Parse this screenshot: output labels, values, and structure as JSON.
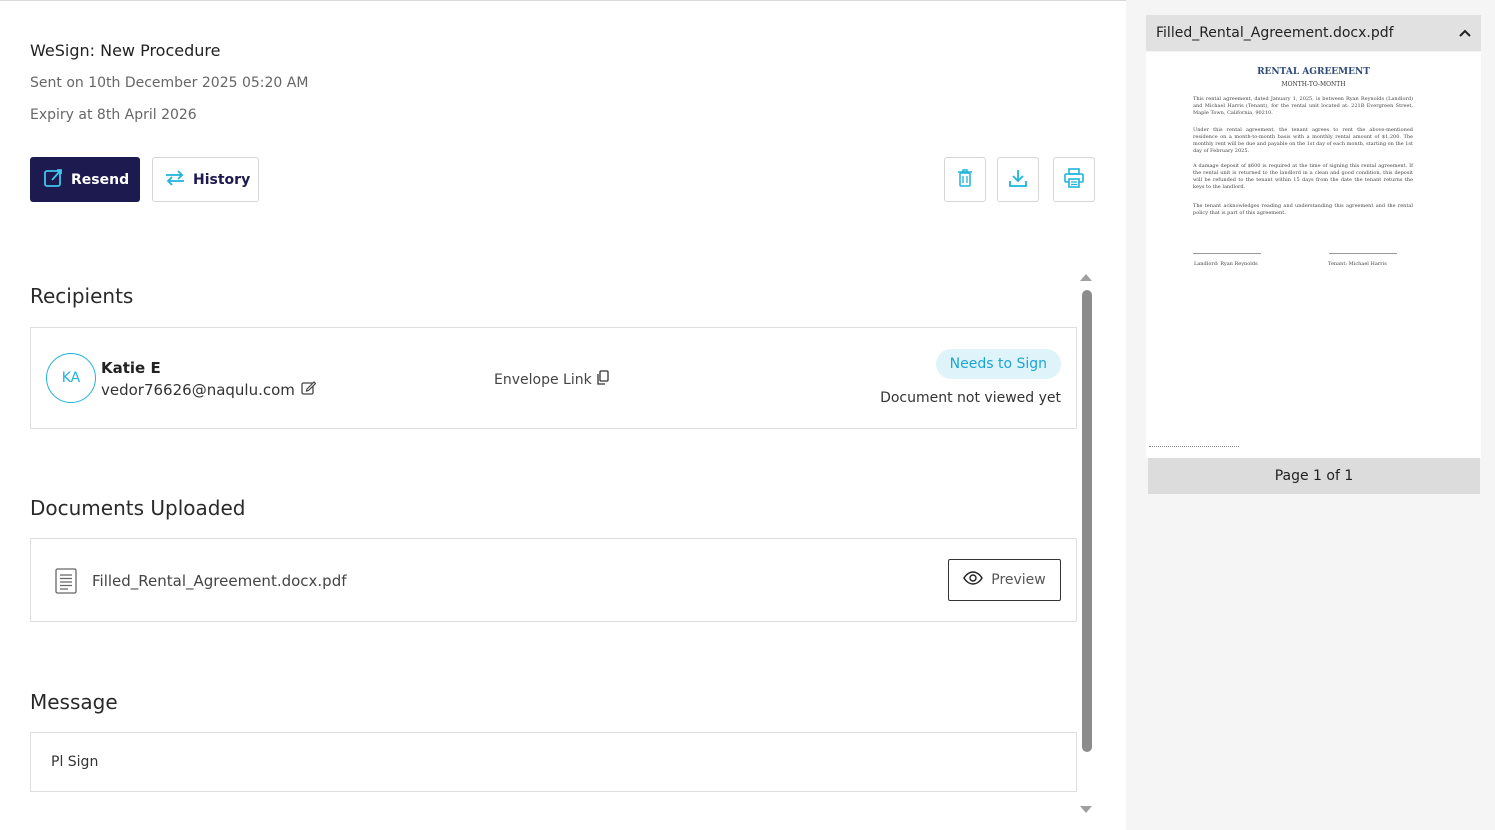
{
  "header": {
    "title": "WeSign: New Procedure",
    "sent": "Sent on 10th December 2025 05:20 AM",
    "expiry": "Expiry at 8th April 2026"
  },
  "actions": {
    "resend_label": "Resend",
    "history_label": "History",
    "icons": [
      "delete-icon",
      "download-icon",
      "print-icon"
    ]
  },
  "recipients": {
    "heading": "Recipients",
    "items": [
      {
        "initials": "KA",
        "name": "Katie E",
        "email": "vedor76626@naqulu.com",
        "envelope_link": "Envelope Link",
        "status": "Needs to Sign",
        "view_status": "Document not viewed yet"
      }
    ]
  },
  "documents": {
    "heading": "Documents Uploaded",
    "items": [
      {
        "name": "Filled_Rental_Agreement.docx.pdf",
        "preview_label": "Preview"
      }
    ]
  },
  "message": {
    "heading": "Message",
    "text": "Pl Sign"
  },
  "preview_panel": {
    "filename": "Filled_Rental_Agreement.docx.pdf",
    "page_indicator": "Page 1 of 1",
    "document": {
      "title": "RENTAL AGREEMENT",
      "subtitle": "MONTH-TO-MONTH",
      "paragraphs": [
        "This rental agreement, dated January 1, 2025, is between Ryan Reynolds (Landlord) and Michael Harris (Tenant), for the rental unit located at: 221B Evergreen Street, Maple Town, California, 90210.",
        "Under this rental agreement, the tenant agrees to rent the above-mentioned residence on a month-to-month basis with a monthly rental amount of $1,200. The monthly rent will be due and payable on the 1st day of each month, starting on the 1st day of February 2025.",
        "A damage deposit of $600 is required at the time of signing this rental agreement. If the rental unit is returned to the landlord in a clean and good condition, this deposit will be refunded to the tenant within 15 days from the date the tenant returns the keys to the landlord.",
        "The tenant acknowledges reading and understanding this agreement and the rental policy that is part of this agreement."
      ],
      "signature_left": "Landlord: Ryan Reynolds",
      "signature_right": "Tenant: Michael Harris"
    }
  },
  "colors": {
    "primary": "#1c1a4e",
    "accent": "#1eb4dc",
    "badge_bg": "#dff3fb"
  }
}
